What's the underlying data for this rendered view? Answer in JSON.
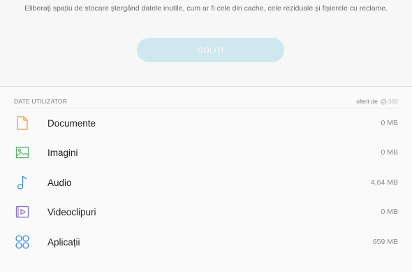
{
  "header": {
    "description": "Eliberați spațiu de stocare ștergând datele inutile, cum ar fi cele din cache, cele reziduale și fișierele cu reclame.",
    "clean_button": "GOLIȚI"
  },
  "user_data": {
    "title": "DATE UTILIZATOR",
    "provider_prefix": "oferit de",
    "provider_name": "360",
    "items": [
      {
        "label": "Documente",
        "size": "0 MB",
        "icon": "document-icon",
        "color": "#f29a3a"
      },
      {
        "label": "Imagini",
        "size": "0 MB",
        "icon": "image-icon",
        "color": "#5bb36a"
      },
      {
        "label": "Audio",
        "size": "4,64 MB",
        "icon": "music-note-icon",
        "color": "#3a8fd9"
      },
      {
        "label": "Videoclipuri",
        "size": "0 MB",
        "icon": "video-icon",
        "color": "#8a6fc9"
      },
      {
        "label": "Aplicații",
        "size": "659 MB",
        "icon": "apps-icon",
        "color": "#3a8fd9"
      }
    ]
  }
}
